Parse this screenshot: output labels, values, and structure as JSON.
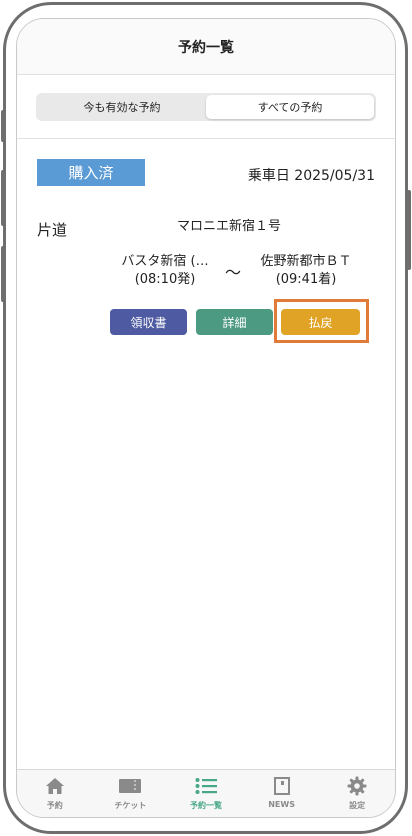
{
  "header": {
    "title": "予約一覧"
  },
  "segments": [
    {
      "label": "今も有効な予約",
      "active": false
    },
    {
      "label": "すべての予約",
      "active": true
    }
  ],
  "reservation": {
    "status": "購入済",
    "ride_date": "乗車日 2025/05/31",
    "trip_type": "片道",
    "service_name": "マロニエ新宿１号",
    "from": {
      "name": "バスタ新宿 (…",
      "time": "(08:10発)"
    },
    "separator": "～",
    "to": {
      "name": "佐野新都市ＢＴ",
      "time": "(09:41着)"
    },
    "buttons": {
      "receipt": "領収書",
      "detail": "詳細",
      "refund": "払戻"
    }
  },
  "tabs": [
    {
      "label": "予約",
      "icon": "home-icon",
      "active": false
    },
    {
      "label": "チケット",
      "icon": "ticket-icon",
      "active": false
    },
    {
      "label": "予約一覧",
      "icon": "list-icon",
      "active": true
    },
    {
      "label": "NEWS",
      "icon": "news-icon",
      "active": false
    },
    {
      "label": "設定",
      "icon": "gear-icon",
      "active": false
    }
  ],
  "colors": {
    "status_badge": "#5b9bd5",
    "receipt_button": "#4e5aa2",
    "detail_button": "#4d9a82",
    "refund_button": "#e0a326",
    "highlight": "#e07b39",
    "active_tab": "#47a886"
  }
}
